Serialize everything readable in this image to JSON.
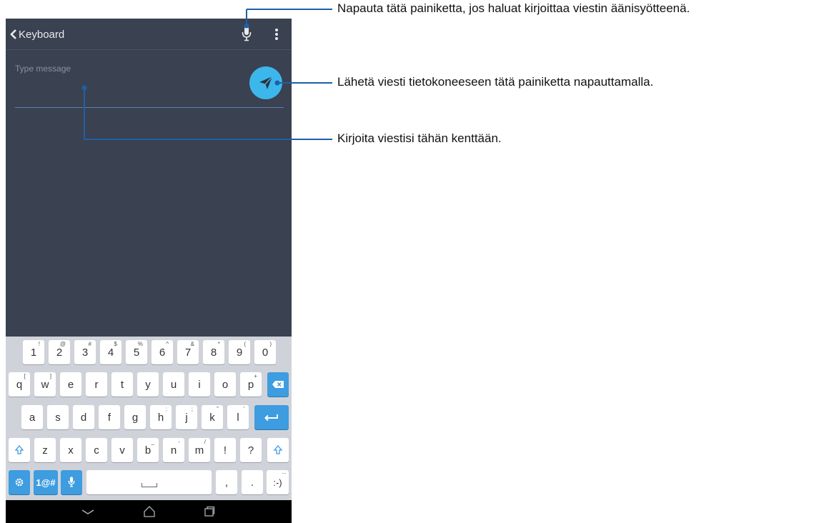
{
  "app_bar": {
    "back_label": "Keyboard",
    "back_icon": "chevron-left-icon",
    "mic_icon": "microphone-icon",
    "more_icon": "more-vert-icon"
  },
  "message": {
    "placeholder": "Type message",
    "value": "",
    "send_icon": "send-icon"
  },
  "keyboard": {
    "row1": [
      {
        "k": "1",
        "s": "!"
      },
      {
        "k": "2",
        "s": "@"
      },
      {
        "k": "3",
        "s": "#"
      },
      {
        "k": "4",
        "s": "$"
      },
      {
        "k": "5",
        "s": "%"
      },
      {
        "k": "6",
        "s": "^"
      },
      {
        "k": "7",
        "s": "&"
      },
      {
        "k": "8",
        "s": "*"
      },
      {
        "k": "9",
        "s": "("
      },
      {
        "k": "0",
        "s": ")"
      }
    ],
    "row2": [
      {
        "k": "q",
        "s": "["
      },
      {
        "k": "w",
        "s": "]"
      },
      {
        "k": "e",
        "s": ""
      },
      {
        "k": "r",
        "s": ""
      },
      {
        "k": "t",
        "s": ""
      },
      {
        "k": "y",
        "s": ""
      },
      {
        "k": "u",
        "s": ""
      },
      {
        "k": "i",
        "s": ""
      },
      {
        "k": "o",
        "s": ""
      },
      {
        "k": "p",
        "s": "+"
      }
    ],
    "row3": [
      {
        "k": "a",
        "s": ""
      },
      {
        "k": "s",
        "s": ""
      },
      {
        "k": "d",
        "s": ""
      },
      {
        "k": "f",
        "s": ""
      },
      {
        "k": "g",
        "s": ""
      },
      {
        "k": "h",
        "s": ":"
      },
      {
        "k": "j",
        "s": ";"
      },
      {
        "k": "k",
        "s": "\""
      },
      {
        "k": "l",
        "s": "'"
      }
    ],
    "row4": [
      {
        "k": "z",
        "s": ""
      },
      {
        "k": "x",
        "s": ""
      },
      {
        "k": "c",
        "s": ""
      },
      {
        "k": "v",
        "s": ""
      },
      {
        "k": "b",
        "s": "_"
      },
      {
        "k": "n",
        "s": "-"
      },
      {
        "k": "m",
        "s": "/"
      },
      {
        "k": "!",
        "s": ""
      },
      {
        "k": "?",
        "s": ""
      }
    ],
    "symbols_label": "1@#",
    "comma": ",",
    "period": ".",
    "emoji": ":-)",
    "emoji_sup": "...",
    "shift_icon": "shift-icon",
    "backspace_icon": "backspace-icon",
    "enter_icon": "enter-icon",
    "settings_icon": "gear-icon",
    "voice_icon": "microphone-icon",
    "space_icon": "space-icon"
  },
  "navbar": {
    "back_icon": "chevron-down-icon",
    "home_icon": "home-icon",
    "recents_icon": "recents-icon"
  },
  "callouts": [
    {
      "text": "Napauta tätä painiketta, jos haluat kirjoittaa viestin äänisyötteenä."
    },
    {
      "text": "Lähetä viesti tietokoneeseen tätä painiketta napauttamalla."
    },
    {
      "text": "Kirjoita viestisi tähän kenttään."
    }
  ],
  "colors": {
    "screen_bg": "#3a4150",
    "accent": "#3cb7ec",
    "key_blue": "#3e9ce0",
    "callout_line": "#1f5fa8"
  }
}
